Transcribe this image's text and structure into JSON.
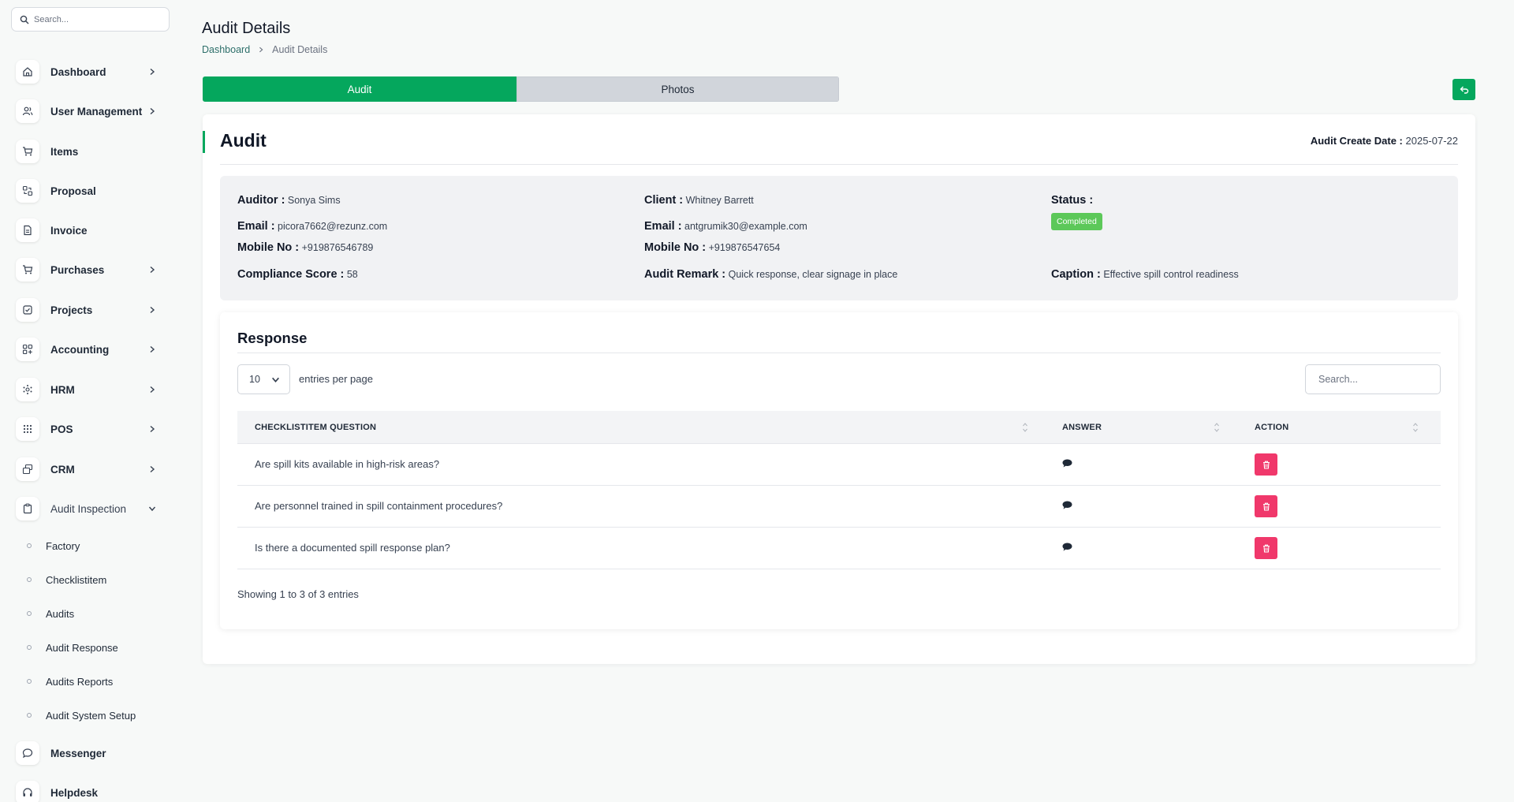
{
  "sidebar": {
    "search_placeholder": "Search...",
    "items": [
      {
        "label": "Dashboard",
        "icon": "home-icon",
        "chevron": "right"
      },
      {
        "label": "User Management",
        "icon": "users-icon",
        "chevron": "right"
      },
      {
        "label": "Items",
        "icon": "cart-icon",
        "chevron": ""
      },
      {
        "label": "Proposal",
        "icon": "proposal-icon",
        "chevron": ""
      },
      {
        "label": "Invoice",
        "icon": "invoice-icon",
        "chevron": ""
      },
      {
        "label": "Purchases",
        "icon": "cart-icon",
        "chevron": "right"
      },
      {
        "label": "Projects",
        "icon": "checkbox-icon",
        "chevron": "right"
      },
      {
        "label": "Accounting",
        "icon": "grid-plus-icon",
        "chevron": "right"
      },
      {
        "label": "HRM",
        "icon": "hrm-icon",
        "chevron": "right"
      },
      {
        "label": "POS",
        "icon": "dots-grid-icon",
        "chevron": "right"
      },
      {
        "label": "CRM",
        "icon": "layers-icon",
        "chevron": "right"
      },
      {
        "label": "Audit Inspection",
        "icon": "clipboard-icon",
        "chevron": "down"
      },
      {
        "label": "Messenger",
        "icon": "chat-icon",
        "chevron": ""
      },
      {
        "label": "Helpdesk",
        "icon": "headset-icon",
        "chevron": ""
      }
    ],
    "sub_items": [
      {
        "label": "Factory"
      },
      {
        "label": "Checklistitem"
      },
      {
        "label": "Audits"
      },
      {
        "label": "Audit Response"
      },
      {
        "label": "Audits Reports"
      },
      {
        "label": "Audit System Setup"
      }
    ]
  },
  "header": {
    "title": "Audit Details",
    "breadcrumb": {
      "home": "Dashboard",
      "current": "Audit Details"
    }
  },
  "tabs": [
    {
      "label": "Audit",
      "active": true
    },
    {
      "label": "Photos",
      "active": false
    }
  ],
  "audit": {
    "title": "Audit",
    "create_date_label": "Audit Create Date :",
    "create_date": "2025-07-22",
    "auditor_label": "Auditor :",
    "auditor": "Sonya Sims",
    "auditor_email_label": "Email :",
    "auditor_email": "picora7662@rezunz.com",
    "auditor_mobile_label": "Mobile No :",
    "auditor_mobile": "+919876546789",
    "compliance_label": "Compliance Score :",
    "compliance": "58",
    "client_label": "Client :",
    "client": "Whitney Barrett",
    "client_email_label": "Email :",
    "client_email": "antgrumik30@example.com",
    "client_mobile_label": "Mobile No :",
    "client_mobile": "+919876547654",
    "remark_label": "Audit Remark :",
    "remark": "Quick response, clear signage in place",
    "status_label": "Status :",
    "status": "Completed",
    "caption_label": "Caption :",
    "caption": "Effective spill control readiness"
  },
  "response": {
    "title": "Response",
    "per_page_value": "10",
    "per_page_label": "entries per page",
    "search_placeholder": "Search...",
    "columns": [
      "CHECKLISTITEM QUESTION",
      "ANSWER",
      "ACTION"
    ],
    "rows": [
      {
        "question": "Are spill kits available in high-risk areas?"
      },
      {
        "question": "Are personnel trained in spill containment procedures?"
      },
      {
        "question": "Is there a documented spill response plan?"
      }
    ],
    "showing": "Showing 1 to 3 of 3 entries"
  },
  "colors": {
    "accent": "#05a75d",
    "status_badge": "#5cc859",
    "delete_button": "#f0386b"
  }
}
